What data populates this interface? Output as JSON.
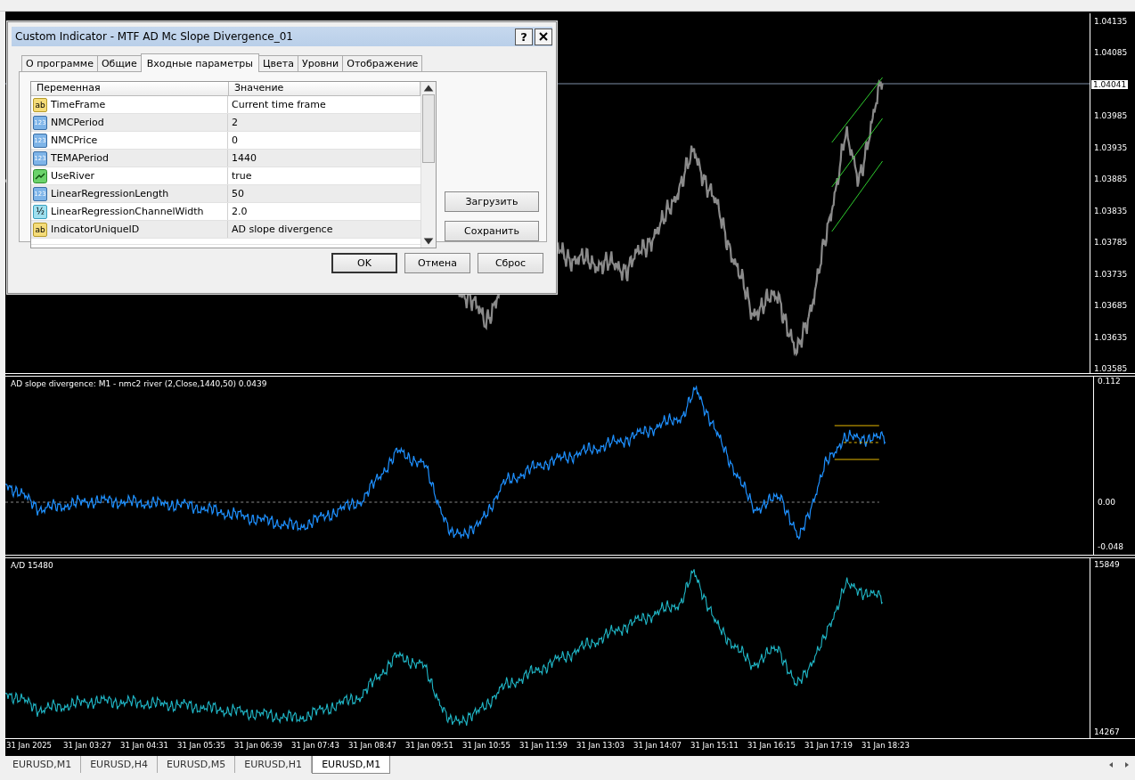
{
  "dialog": {
    "title": "Custom Indicator - MTF AD Mc Slope Divergence_01",
    "help_button": "?",
    "tabs": [
      {
        "label": "О программе",
        "selected": false
      },
      {
        "label": "Общие",
        "selected": false
      },
      {
        "label": "Входные параметры",
        "selected": true
      },
      {
        "label": "Цвета",
        "selected": false
      },
      {
        "label": "Уровни",
        "selected": false
      },
      {
        "label": "Отображение",
        "selected": false
      }
    ],
    "columns": [
      "Переменная",
      "Значение"
    ],
    "rows": [
      {
        "kind": "string",
        "icon_text": "ab",
        "name": "TimeFrame",
        "value": "Current time frame"
      },
      {
        "kind": "int",
        "icon_text": "123",
        "name": "NMCPeriod",
        "value": "2"
      },
      {
        "kind": "int",
        "icon_text": "123",
        "name": "NMCPrice",
        "value": "0"
      },
      {
        "kind": "int",
        "icon_text": "123",
        "name": "TEMAPeriod",
        "value": "1440"
      },
      {
        "kind": "bool",
        "name": "UseRiver",
        "value": "true"
      },
      {
        "kind": "int",
        "icon_text": "123",
        "name": "LinearRegressionLength",
        "value": "50"
      },
      {
        "kind": "double",
        "icon_text": "½",
        "name": "LinearRegressionChannelWidth",
        "value": "2.0"
      },
      {
        "kind": "string",
        "icon_text": "ab",
        "name": "IndicatorUniqueID",
        "value": "AD slope divergence"
      }
    ],
    "side_buttons": [
      "Загрузить",
      "Сохранить"
    ],
    "buttons": [
      "OK",
      "Отмена",
      "Сброс"
    ]
  },
  "chart": {
    "price_axis": [
      {
        "kind": "tick",
        "label": "1.04135"
      },
      {
        "kind": "tick",
        "label": "1.04085"
      },
      {
        "kind": "current",
        "label": "1.04041"
      },
      {
        "kind": "tick",
        "label": "1.03985"
      },
      {
        "kind": "tick",
        "label": "1.03935"
      },
      {
        "kind": "tick",
        "label": "1.03885"
      },
      {
        "kind": "tick",
        "label": "1.03835"
      },
      {
        "kind": "tick",
        "label": "1.03785"
      },
      {
        "kind": "tick",
        "label": "1.03735"
      },
      {
        "kind": "tick",
        "label": "1.03685"
      },
      {
        "kind": "tick",
        "label": "1.03635"
      },
      {
        "kind": "tick",
        "label": "1.03585"
      }
    ],
    "indicator_pane": {
      "label": "AD slope divergence:  M1 - nmc2 river  (2,Close,1440,50) 0.0439",
      "axis": [
        "0.112",
        "0.00",
        "-0.048"
      ]
    },
    "ad_pane": {
      "label": "A/D 15480",
      "axis": [
        "15849",
        "14267"
      ]
    },
    "time_axis": [
      "31 Jan 2025",
      "31 Jan 03:27",
      "31 Jan 04:31",
      "31 Jan 05:35",
      "31 Jan 06:39",
      "31 Jan 07:43",
      "31 Jan 08:47",
      "31 Jan 09:51",
      "31 Jan 10:55",
      "31 Jan 11:59",
      "31 Jan 13:03",
      "31 Jan 14:07",
      "31 Jan 15:11",
      "31 Jan 16:15",
      "31 Jan 17:19",
      "31 Jan 18:23"
    ]
  },
  "symbol_tabs": [
    {
      "label": "EURUSD,M1",
      "selected": false
    },
    {
      "label": "EURUSD,H4",
      "selected": false
    },
    {
      "label": "EURUSD,M5",
      "selected": false
    },
    {
      "label": "EURUSD,H1",
      "selected": false
    },
    {
      "label": "EURUSD,M1",
      "selected": true
    }
  ]
}
